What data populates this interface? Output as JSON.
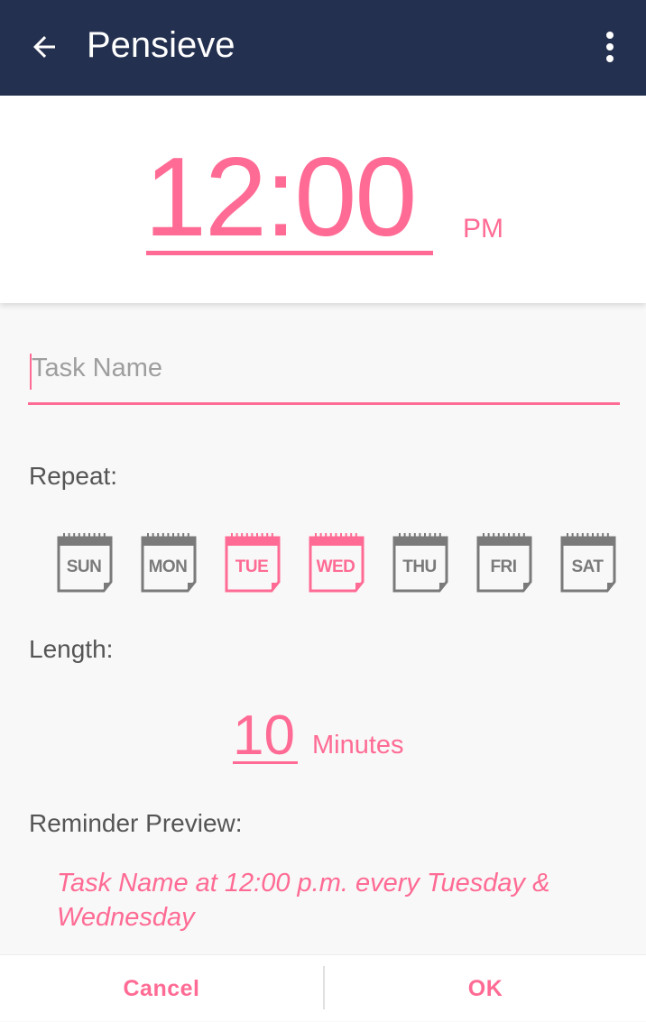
{
  "appbar": {
    "title": "Pensieve",
    "back_icon": "arrow-back-icon",
    "menu_icon": "more-vert-icon",
    "background": "#24304f"
  },
  "time": {
    "value": "12:00",
    "ampm": "PM"
  },
  "task": {
    "placeholder": "Task Name",
    "value": ""
  },
  "repeat": {
    "label": "Repeat:",
    "days": [
      {
        "label": "SUN",
        "selected": false
      },
      {
        "label": "MON",
        "selected": false
      },
      {
        "label": "TUE",
        "selected": true
      },
      {
        "label": "WED",
        "selected": true
      },
      {
        "label": "THU",
        "selected": false
      },
      {
        "label": "FRI",
        "selected": false
      },
      {
        "label": "SAT",
        "selected": false
      }
    ]
  },
  "length": {
    "label": "Length:",
    "value": "10",
    "unit": "Minutes"
  },
  "preview": {
    "label": "Reminder Preview:",
    "text": "Task Name at 12:00 p.m. every Tuesday & Wednesday"
  },
  "footer": {
    "cancel_label": "Cancel",
    "ok_label": "OK"
  },
  "colors": {
    "accent": "#ff6b94",
    "inactive": "#7a7a7a",
    "text": "#555555"
  }
}
